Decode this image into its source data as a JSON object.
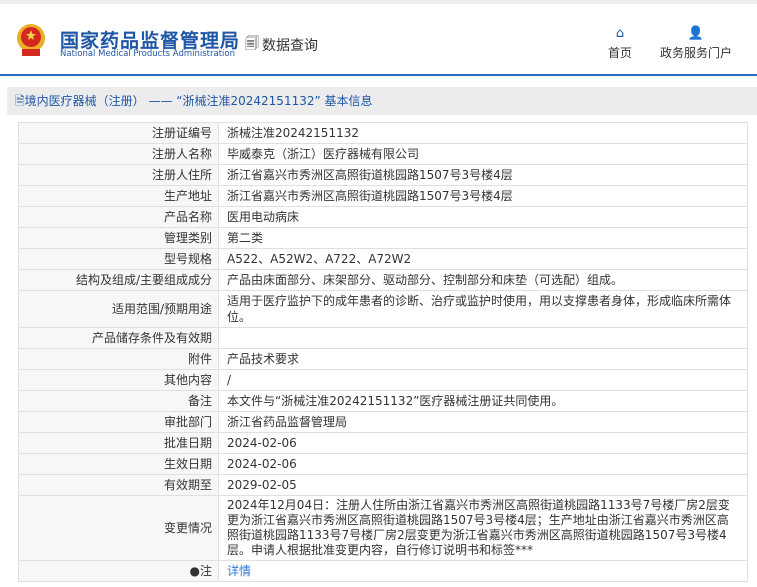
{
  "header": {
    "logo_cn": "国家药品监督管理局",
    "logo_en": "National Medical Products Administration",
    "section": "数据查询",
    "nav": [
      {
        "label": "首页",
        "icon": "home-icon"
      },
      {
        "label": "政务服务门户",
        "icon": "user-icon"
      }
    ]
  },
  "title": "境内医疗器械（注册） —— “浙械注准20242151132” 基本信息",
  "rows": [
    {
      "label": "注册证编号",
      "value": "浙械注准20242151132"
    },
    {
      "label": "注册人名称",
      "value": "毕威泰克（浙江）医疗器械有限公司"
    },
    {
      "label": "注册人住所",
      "value": "浙江省嘉兴市秀洲区高照街道桃园路1507号3号楼4层"
    },
    {
      "label": "生产地址",
      "value": "浙江省嘉兴市秀洲区高照街道桃园路1507号3号楼4层"
    },
    {
      "label": "产品名称",
      "value": "医用电动病床"
    },
    {
      "label": "管理类别",
      "value": "第二类"
    },
    {
      "label": "型号规格",
      "value": "A522、A52W2、A722、A72W2"
    },
    {
      "label": "结构及组成/主要组成成分",
      "value": "产品由床面部分、床架部分、驱动部分、控制部分和床垫（可选配）组成。"
    },
    {
      "label": "适用范围/预期用途",
      "value": "适用于医疗监护下的成年患者的诊断、治疗或监护时使用，用以支撑患者身体，形成临床所需体位。"
    },
    {
      "label": "产品储存条件及有效期",
      "value": ""
    },
    {
      "label": "附件",
      "value": "产品技术要求"
    },
    {
      "label": "其他内容",
      "value": "/"
    },
    {
      "label": "备注",
      "value": "本文件与“浙械注准20242151132”医疗器械注册证共同使用。"
    },
    {
      "label": "审批部门",
      "value": "浙江省药品监督管理局"
    },
    {
      "label": "批准日期",
      "value": "2024-02-06"
    },
    {
      "label": "生效日期",
      "value": "2024-02-06"
    },
    {
      "label": "有效期至",
      "value": "2029-02-05"
    },
    {
      "label": "变更情况",
      "value": "2024年12月04日：注册人住所由浙江省嘉兴市秀洲区高照街道桃园路1133号7号楼厂房2层变更为浙江省嘉兴市秀洲区高照街道桃园路1507号3号楼4层；生产地址由浙江省嘉兴市秀洲区高照街道桃园路1133号7号楼厂房2层变更为浙江省嘉兴市秀洲区高照街道桃园路1507号3号楼4层。申请人根据批准变更内容，自行修订说明书和标签***"
    }
  ],
  "note": {
    "label": "注",
    "link": "详情"
  }
}
